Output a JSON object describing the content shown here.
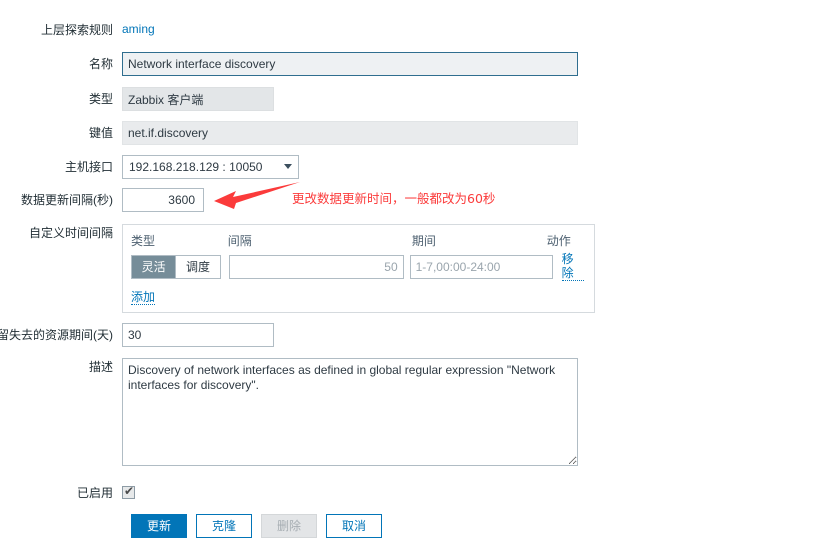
{
  "form": {
    "parent_rule": {
      "label": "上层探索规则",
      "value": "aming"
    },
    "name": {
      "label": "名称",
      "value": "Network interface discovery"
    },
    "type": {
      "label": "类型",
      "value": "Zabbix 客户端"
    },
    "key": {
      "label": "键值",
      "value": "net.if.discovery"
    },
    "host_interface": {
      "label": "主机接口",
      "value": "192.168.218.129 : 10050"
    },
    "update_interval": {
      "label": "数据更新间隔(秒)",
      "value": "3600"
    },
    "custom_intervals": {
      "label": "自定义时间间隔",
      "headers": [
        "类型",
        "间隔",
        "期间",
        "动作"
      ],
      "rows": [
        {
          "type_options": [
            "灵活",
            "调度"
          ],
          "type_selected": "灵活",
          "interval_value": "",
          "interval_placeholder": "50",
          "period_value": "",
          "period_placeholder": "1-7,00:00-24:00",
          "remove_label": "移除"
        }
      ],
      "add_label": "添加"
    },
    "lost_resources": {
      "label": "保留失去的资源期间(天)",
      "value": "30"
    },
    "description": {
      "label": "描述",
      "value": "Discovery of network interfaces as defined in global regular expression \"Network interfaces for discovery\"."
    },
    "enabled": {
      "label": "已启用",
      "checked": true
    }
  },
  "buttons": {
    "update": "更新",
    "clone": "克隆",
    "delete": "删除",
    "cancel": "取消"
  },
  "annotation": {
    "text": "更改数据更新时间，一般都改为60秒",
    "color": "#fb3b3b"
  }
}
